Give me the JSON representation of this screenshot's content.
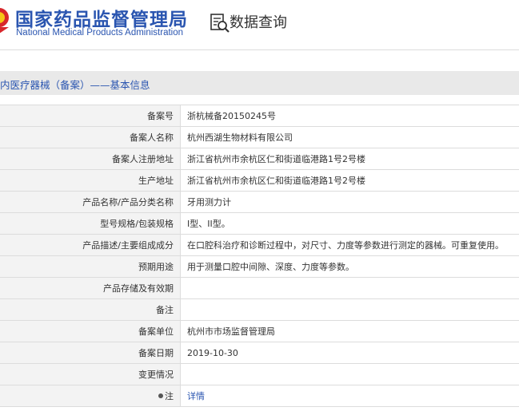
{
  "header": {
    "agency_cn": "国家药品监督管理局",
    "agency_en": "National Medical Products Administration",
    "data_query": "数据查询",
    "brand_color": "#2a55b0"
  },
  "section": {
    "title": "内医疗器械（备案）——基本信息"
  },
  "rows": [
    {
      "label": "备案号",
      "value": "浙杭械备20150245号"
    },
    {
      "label": "备案人名称",
      "value": "杭州西湖生物材料有限公司"
    },
    {
      "label": "备案人注册地址",
      "value": "浙江省杭州市余杭区仁和街道临港路1号2号楼"
    },
    {
      "label": "生产地址",
      "value": "浙江省杭州市余杭区仁和街道临港路1号2号楼"
    },
    {
      "label": "产品名称/产品分类名称",
      "value": "牙用测力计"
    },
    {
      "label": "型号规格/包装规格",
      "value": "I型、II型。"
    },
    {
      "label": "产品描述/主要组成成分",
      "value": "在口腔科治疗和诊断过程中，对尺寸、力度等参数进行测定的器械。可重复使用。"
    },
    {
      "label": "预期用途",
      "value": "用于测量口腔中间隙、深度、力度等参数。"
    },
    {
      "label": "产品存储及有效期",
      "value": ""
    },
    {
      "label": "备注",
      "value": ""
    },
    {
      "label": "备案单位",
      "value": "杭州市市场监督管理局"
    },
    {
      "label": "备案日期",
      "value": "2019-10-30"
    },
    {
      "label": "变更情况",
      "value": ""
    },
    {
      "label": "注",
      "value": "详情"
    }
  ]
}
